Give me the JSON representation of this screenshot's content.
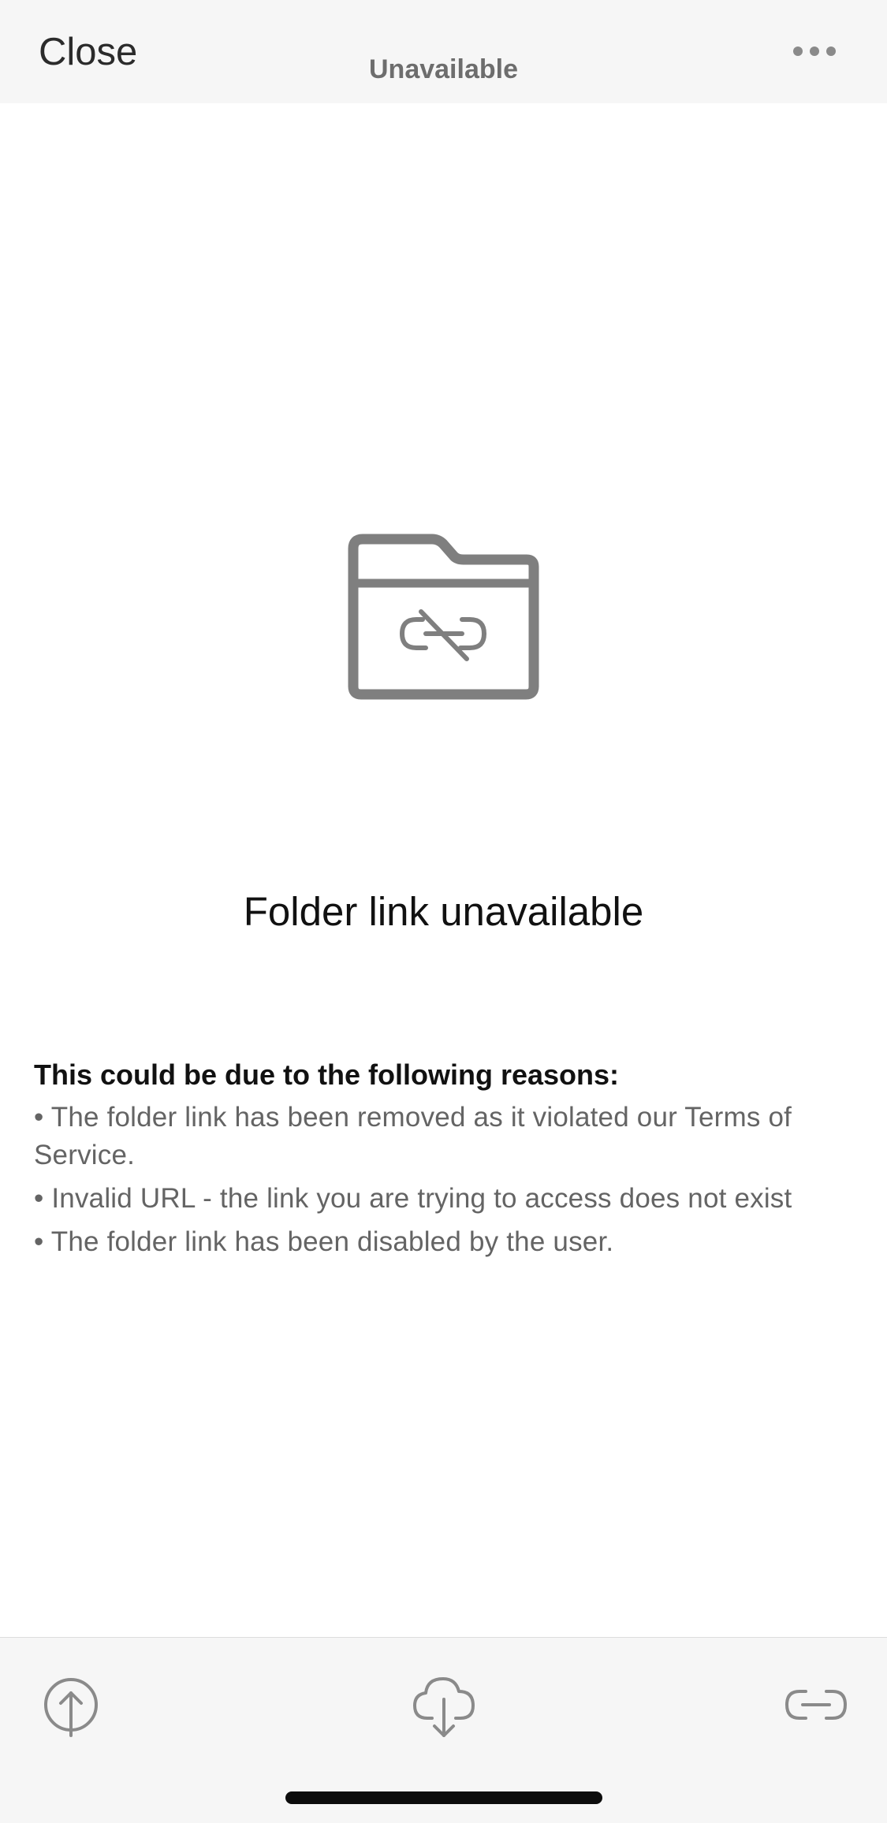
{
  "header": {
    "close_label": "Close",
    "title": "Unavailable",
    "more_icon": "more-horizontal-icon"
  },
  "empty_state": {
    "icon": "folder-broken-link-icon",
    "title": "Folder link unavailable",
    "reasons_heading": "This could be due to the following reasons:",
    "reasons": [
      "• The folder link has been removed as it violated our Terms of Service.",
      "• Invalid URL - the link you are trying to access does not exist",
      "• The folder link has been disabled by the user."
    ]
  },
  "toolbar": {
    "upload_icon": "upload-icon",
    "download_icon": "cloud-download-icon",
    "link_icon": "link-icon"
  },
  "colors": {
    "icon_gray": "#7f7f7f",
    "header_bg": "#f6f6f6",
    "text_primary": "#111111",
    "text_secondary": "#646464"
  }
}
